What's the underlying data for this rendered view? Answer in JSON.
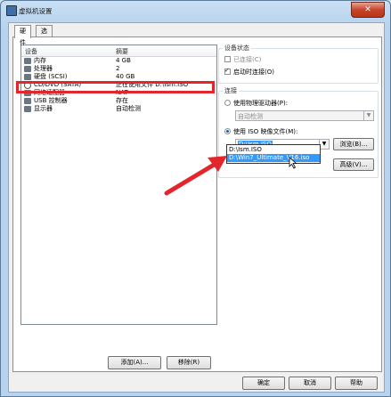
{
  "window": {
    "title": "虚拟机设置",
    "close_label": "✕"
  },
  "tabs": [
    {
      "label": "硬件"
    },
    {
      "label": "选项"
    }
  ],
  "device_list": {
    "col_device": "设备",
    "col_summary": "摘要",
    "rows": [
      {
        "name": "内存",
        "value": "4 GB"
      },
      {
        "name": "处理器",
        "value": "2"
      },
      {
        "name": "硬盘 (SCSI)",
        "value": "40 GB"
      },
      {
        "name": "CD/DVD (SATA)",
        "value": "正在使用文件 D:\\Ism.ISO"
      },
      {
        "name": "网络适配器",
        "value": "NAT"
      },
      {
        "name": "USB 控制器",
        "value": "存在"
      },
      {
        "name": "显示器",
        "value": "自动检测"
      }
    ]
  },
  "buttons": {
    "add": "添加(A)...",
    "remove": "移除(R)"
  },
  "device_status": {
    "title": "设备状态",
    "connected": "已连接(C)",
    "connect_on_power": "启动时连接(O)"
  },
  "connection": {
    "title": "连接",
    "physical": "使用物理驱动器(P):",
    "physical_value": "自动检测",
    "iso": "使用 ISO 映像文件(M):",
    "iso_value": "D:\\Ism.ISO",
    "browse": "浏览(B)...",
    "advanced": "高级(V)...",
    "options": [
      "D:\\Ism.ISO",
      "D:\\Win7_Ultimate_V16.iso"
    ]
  },
  "footer": {
    "ok": "确定",
    "cancel": "取消",
    "help": "帮助"
  }
}
